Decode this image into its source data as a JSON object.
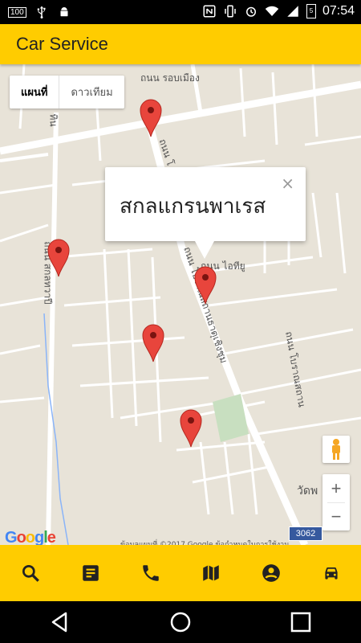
{
  "status_bar": {
    "battery_percent_left": "100",
    "time": "07:54",
    "battery_percent_right": "5"
  },
  "app_bar": {
    "title": "Car Service"
  },
  "map": {
    "type_control": {
      "map_label": "แผนที่",
      "satellite_label": "ดาวเทียม",
      "selected": "map"
    },
    "info_window": {
      "title": "สกลแกรนพาเรส",
      "close_label": "×"
    },
    "labels": {
      "road_top": "ถนน รอบเมือง",
      "road_left": "ถนน สกลทวาปี",
      "road_center_1": "ถนน โ",
      "road_center_2": "ถนน โบราณสถานธาตุเชิงชุม",
      "road_small": "ถนน ไอทียู",
      "road_right": "ถนน โบราณสถาน",
      "place_bottom_right": "วัดพ",
      "road_left_top": "ทิน"
    },
    "route_sign": "3062",
    "google_logo": "Google",
    "copyright": "ข้อมูลแผนที่ ©2017 Google   ข้อกำหนดในการใช้งาน",
    "zoom": {
      "in": "+",
      "out": "−"
    },
    "pin_color": "#e8453c",
    "pins": [
      {
        "name": "pin-1"
      },
      {
        "name": "pin-2"
      },
      {
        "name": "pin-3"
      },
      {
        "name": "pin-4"
      },
      {
        "name": "pin-5"
      }
    ]
  },
  "bottom_nav": {
    "accent": "#ffcc00",
    "items": [
      {
        "icon": "search-icon"
      },
      {
        "icon": "document-icon"
      },
      {
        "icon": "phone-icon"
      },
      {
        "icon": "map-icon"
      },
      {
        "icon": "account-icon"
      },
      {
        "icon": "car-icon"
      }
    ]
  },
  "system_nav": {
    "items": [
      "back-icon",
      "home-icon",
      "recents-icon"
    ]
  }
}
